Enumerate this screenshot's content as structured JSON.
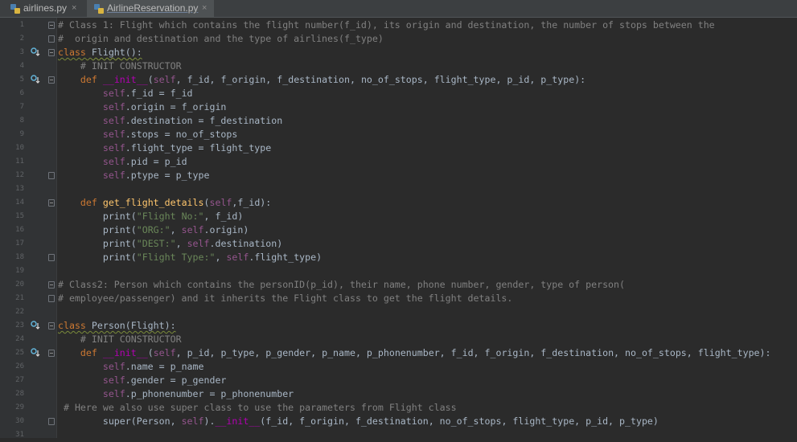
{
  "tabs": [
    {
      "label": "airlines.py",
      "close": "×",
      "active": false
    },
    {
      "label": "AirlineReservation.py",
      "close": "×",
      "active": true
    }
  ],
  "colors": {
    "background": "#2b2b2b",
    "gutter": "#313335",
    "keyword": "#cc7832",
    "comment": "#808080",
    "string": "#6a8759",
    "self": "#94558d",
    "function": "#ffc66d",
    "magic": "#b200b2",
    "text": "#a9b7c6"
  },
  "icons": {
    "tab_file": "python-file-icon",
    "gutter_override": "override-arrow-icon",
    "fold": "fold-marker-icon"
  },
  "lines": [
    "# Class 1: Flight which contains the flight number(f_id), its origin and destination, the number of stops between the",
    "#  origin and destination and the type of airlines(f_type)",
    "class Flight():",
    "    # INIT CONSTRUCTOR",
    "    def __init__(self, f_id, f_origin, f_destination, no_of_stops, flight_type, p_id, p_type):",
    "        self.f_id = f_id",
    "        self.origin = f_origin",
    "        self.destination = f_destination",
    "        self.stops = no_of_stops",
    "        self.flight_type = flight_type",
    "        self.pid = p_id",
    "        self.ptype = p_type",
    "",
    "    def get_flight_details(self,f_id):",
    "        print(\"Flight No:\", f_id)",
    "        print(\"ORG:\", self.origin)",
    "        print(\"DEST:\", self.destination)",
    "        print(\"Flight Type:\", self.flight_type)",
    "",
    "# Class2: Person which contains the personID(p_id), their name, phone number, gender, type of person(",
    "# employee/passenger) and it inherits the Flight class to get the flight details.",
    "",
    "class Person(Flight):",
    "    # INIT CONSTRUCTOR",
    "    def __init__(self, p_id, p_type, p_gender, p_name, p_phonenumber, f_id, f_origin, f_destination, no_of_stops, flight_type):",
    "        self.name = p_name",
    "        self.gender = p_gender",
    "        self.p_phonenumber = p_phonenumber",
    " # Here we also use super class to use the parameters from Flight class",
    "        super(Person, self).__init__(f_id, f_origin, f_destination, no_of_stops, flight_type, p_id, p_type)",
    ""
  ],
  "line_numbers": [
    "1",
    "2",
    "3",
    "4",
    "5",
    "6",
    "7",
    "8",
    "9",
    "10",
    "11",
    "12",
    "13",
    "14",
    "15",
    "16",
    "17",
    "18",
    "19",
    "20",
    "21",
    "22",
    "23",
    "24",
    "25",
    "26",
    "27",
    "28",
    "29",
    "30",
    "31"
  ]
}
